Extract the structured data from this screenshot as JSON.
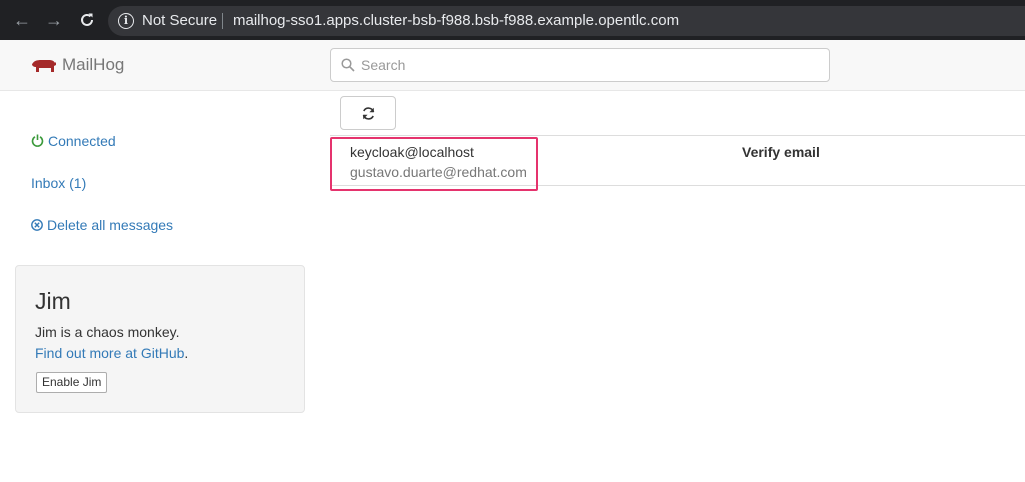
{
  "browser": {
    "security_label": "Not Secure",
    "url": "mailhog-sso1.apps.cluster-bsb-f988.bsb-f988.example.opentlc.com"
  },
  "header": {
    "brand": "MailHog",
    "search_placeholder": "Search"
  },
  "sidebar": {
    "connected_label": "Connected",
    "inbox_label": "Inbox (1)",
    "delete_all_label": "Delete all messages"
  },
  "jim": {
    "title": "Jim",
    "description": "Jim is a chaos monkey.",
    "link_text": "Find out more at GitHub",
    "link_suffix": ".",
    "enable_button": "Enable Jim"
  },
  "messages": [
    {
      "from": "keycloak@localhost",
      "to": "gustavo.duarte@redhat.com",
      "subject": "Verify email"
    }
  ],
  "colors": {
    "link": "#337ab7",
    "highlight": "#e5336d",
    "logo": "#a52a2a"
  }
}
